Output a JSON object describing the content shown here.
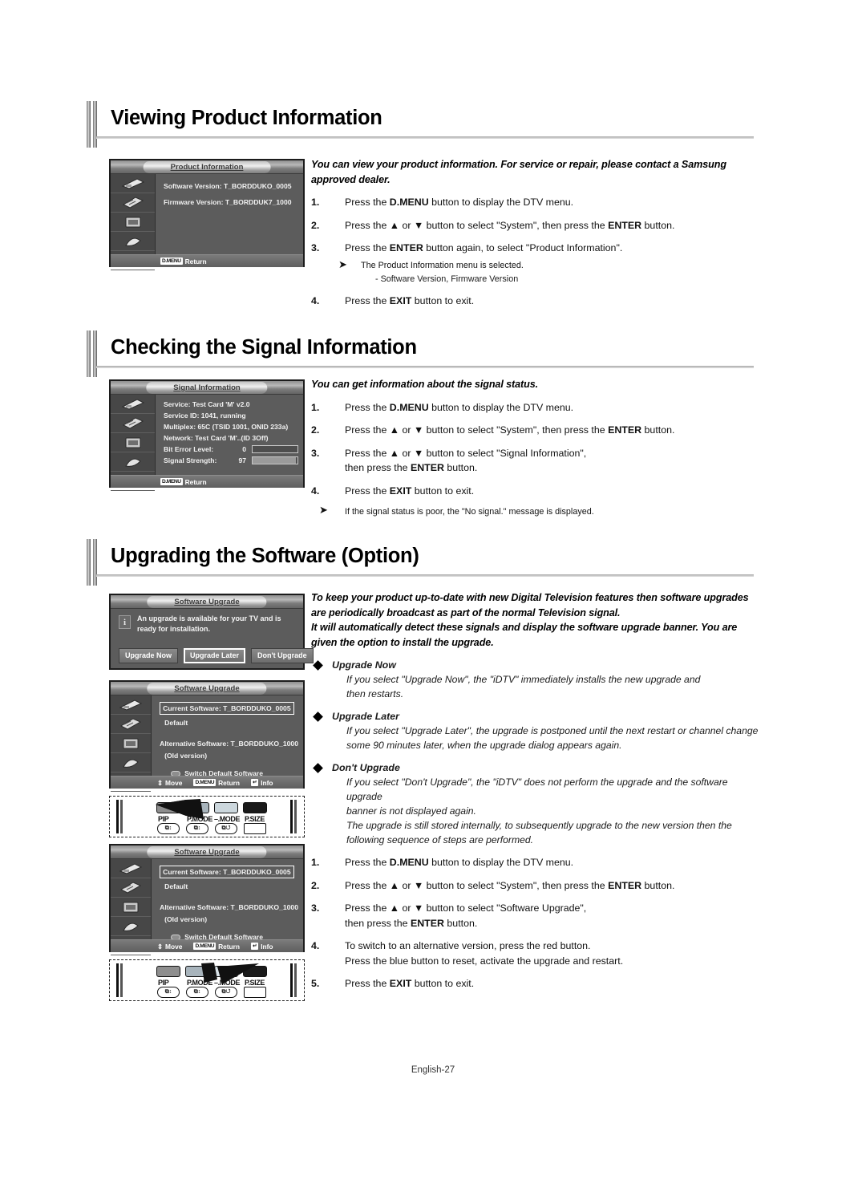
{
  "footer": {
    "page_label": "English-27"
  },
  "sections": [
    {
      "title": "Viewing Product Information",
      "lead": "You can view your product information. For service or repair, please contact a Samsung approved dealer.",
      "osd": {
        "title": "Product Information",
        "lines": [
          "Software Version:  T_BORDDUKO_0005",
          "Firmware Version:  T_BORDDUK7_1000"
        ],
        "footer_key": "D.MENU",
        "footer_label": "Return"
      },
      "steps": [
        {
          "num": "1.",
          "text_pre": "Press the ",
          "bold": "D.MENU",
          "text_post": " button to display the DTV menu."
        },
        {
          "num": "2.",
          "text_pre": "Press the ▲ or ▼ button to select \"System\", then press the ",
          "bold": "ENTER",
          "text_post": " button."
        },
        {
          "num": "3.",
          "text_pre": "Press the ",
          "bold": "ENTER",
          "text_post": " button again, to select \"Product Information\"."
        },
        {
          "num": "4.",
          "text_pre": "Press the ",
          "bold": "EXIT",
          "text_post": " button to exit."
        }
      ],
      "note": "The Product Information menu is selected.",
      "subnote": "- Software Version, Firmware Version"
    },
    {
      "title": "Checking the Signal Information",
      "lead": "You can get information about the signal status.",
      "osd": {
        "title": "Signal Information",
        "lines": [
          "Service: Test Card 'M' v2.0",
          "Service ID: 1041, running",
          "Multiplex: 65C (TSID 1001, ONID 233a)",
          "Network: Test Card 'M'..(ID 3Off)"
        ],
        "meters": [
          {
            "label": "Bit Error Level:",
            "value": "0",
            "percent": 0
          },
          {
            "label": "Signal Strength:",
            "value": "97",
            "percent": 97
          }
        ],
        "footer_key": "D.MENU",
        "footer_label": "Return"
      },
      "steps": [
        {
          "num": "1.",
          "text_pre": "Press the ",
          "bold": "D.MENU",
          "text_post": " button to display the DTV menu."
        },
        {
          "num": "2.",
          "text_pre": "Press the ▲ or ▼ button to select \"System\", then press the ",
          "bold": "ENTER",
          "text_post": " button."
        },
        {
          "num": "3.",
          "text_pre": "Press the ▲ or ▼ button to select \"Signal Information\",",
          "bold": "",
          "text_post": "",
          "line2_pre": "then press the ",
          "line2_bold": "ENTER",
          "line2_post": " button."
        },
        {
          "num": "4.",
          "text_pre": "Press the ",
          "bold": "EXIT",
          "text_post": " button to exit."
        }
      ],
      "note": "If the signal status is poor, the \"No signal.\" message is displayed."
    },
    {
      "title": "Upgrading the Software (Option)",
      "lead_lines": [
        "To keep your product up-to-date with new Digital Television features then software upgrades",
        "are periodically broadcast as part of the normal Television signal.",
        "It will automatically detect these signals and display the software upgrade banner. You are",
        "given the option to install the upgrade."
      ],
      "banner_osd": {
        "title": "Software Upgrade",
        "info_icon": "i",
        "message": "An upgrade is available for your TV and is ready for installation.",
        "buttons": [
          {
            "label": "Upgrade Now",
            "selected": false
          },
          {
            "label": "Upgrade Later",
            "selected": true
          },
          {
            "label": "Don't Upgrade",
            "selected": false
          }
        ]
      },
      "upgrade_osd": {
        "title": "Software Upgrade",
        "current_label": "Current Software: T_BORDDUKO_0005",
        "current_sub": "Default",
        "alt_label": "Alternative Software: T_BORDDUKO_1000",
        "alt_sub": "(Old version)",
        "switch_label": "Switch Default Software",
        "footer": {
          "move": "Move",
          "key": "D.MENU",
          "return": "Return",
          "info_key": "↵",
          "info": "Info"
        }
      },
      "remotes": [
        {
          "caps": [
            {
              "label": "PIP",
              "key": "⧉↕"
            },
            {
              "label": "P.MODE",
              "key": "⧉↕"
            },
            {
              "label": "–.MODE",
              "key": "⧉↺"
            },
            {
              "label": "P.SIZE",
              "key": ""
            }
          ],
          "arrow_dir": "left"
        },
        {
          "caps": [
            {
              "label": "PIP",
              "key": "⧉↕"
            },
            {
              "label": "P.MODE",
              "key": "⧉↕"
            },
            {
              "label": "–.MODE",
              "key": "⧉↺"
            },
            {
              "label": "P.SIZE",
              "key": ""
            }
          ],
          "arrow_dir": "right"
        }
      ],
      "bullets": [
        {
          "head": "Upgrade Now",
          "lines": [
            "If you select \"Upgrade Now\", the \"iDTV\" immediately installs the new upgrade and",
            "then restarts."
          ]
        },
        {
          "head": "Upgrade Later",
          "lines": [
            "If you select \"Upgrade Later\", the upgrade is postponed until the next restart or channel change",
            "some 90 minutes later, when the upgrade dialog appears again."
          ]
        },
        {
          "head": "Don't Upgrade",
          "lines": [
            "If you select \"Don't Upgrade\", the \"iDTV\" does not perform the upgrade and the software upgrade",
            "banner is not displayed again.",
            "The upgrade is still stored internally, to subsequently upgrade to the new version then the",
            "following sequence of steps are performed."
          ]
        }
      ],
      "steps": [
        {
          "num": "1.",
          "text_pre": "Press the ",
          "bold": "D.MENU",
          "text_post": " button to display the DTV menu."
        },
        {
          "num": "2.",
          "text_pre": "Press the ▲ or ▼ button to select \"System\", then press the ",
          "bold": "ENTER",
          "text_post": " button."
        },
        {
          "num": "3.",
          "text_pre": "Press the ▲ or ▼ button to select \"Software Upgrade\",",
          "bold": "",
          "text_post": "",
          "line2_pre": "then press the ",
          "line2_bold": "ENTER",
          "line2_post": " button."
        },
        {
          "num": "4.",
          "text_pre": "To switch to an alternative version, press the red button.",
          "bold": "",
          "text_post": "",
          "line2_pre": "Press the blue button to reset, activate the upgrade and restart.",
          "line2_bold": "",
          "line2_post": ""
        },
        {
          "num": "5.",
          "text_pre": "Press the ",
          "bold": "EXIT",
          "text_post": " button to exit."
        }
      ]
    }
  ]
}
